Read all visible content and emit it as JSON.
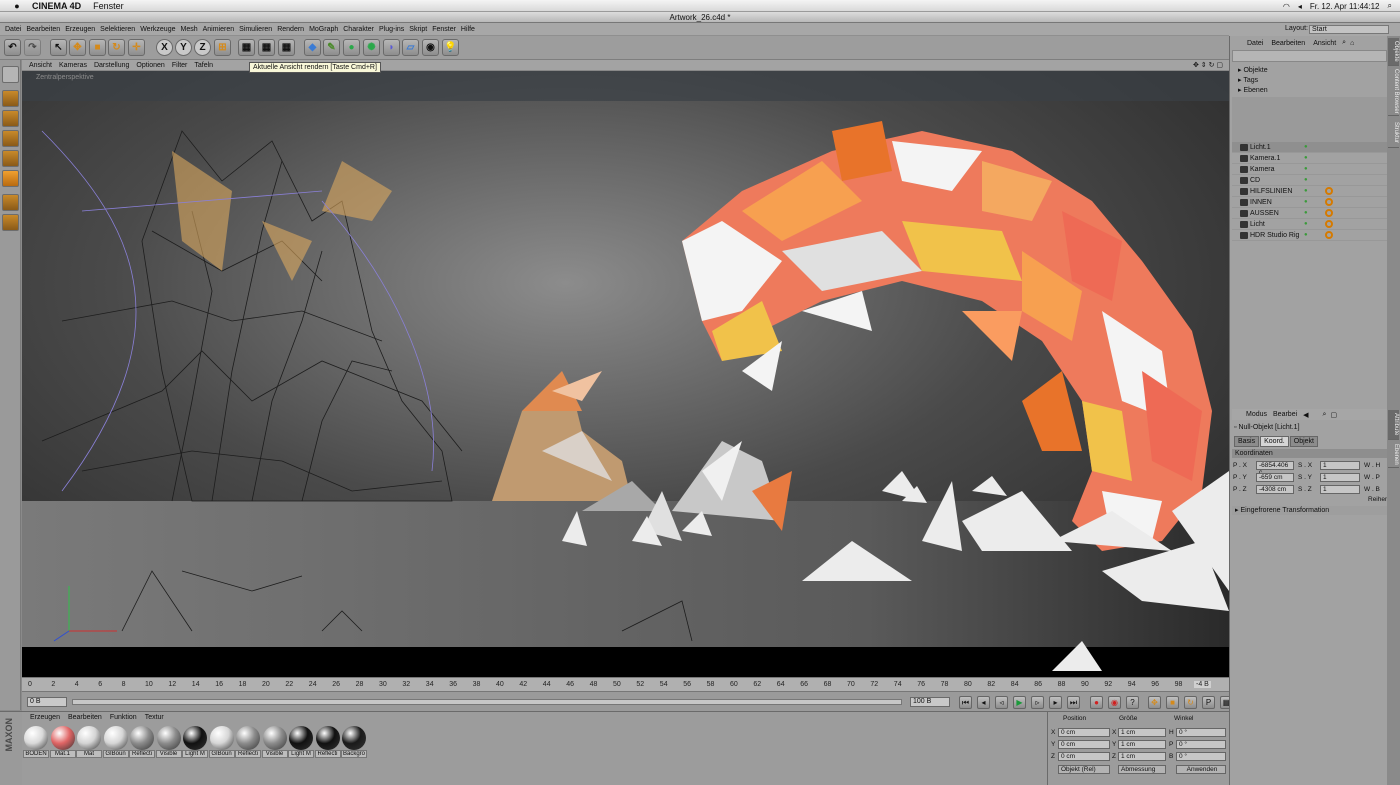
{
  "mac_menu": {
    "app": "CINEMA 4D",
    "window_menu": "Fenster",
    "date_time": "Fr. 12. Apr  11:44:12"
  },
  "window": {
    "title": "Artwork_26.c4d *"
  },
  "main_menu": [
    "Datei",
    "Bearbeiten",
    "Erzeugen",
    "Selektieren",
    "Werkzeuge",
    "Mesh",
    "Animieren",
    "Simulieren",
    "Rendern",
    "MoGraph",
    "Charakter",
    "Plug-ins",
    "Skript",
    "Fenster",
    "Hilfe"
  ],
  "layout": {
    "label": "Layout:",
    "value": "Start"
  },
  "toolbar": {
    "x": "X",
    "y": "Y",
    "z": "Z"
  },
  "tooltip": "Aktuelle Ansicht rendern [Taste Cmd+R]",
  "viewport_menu": [
    "Ansicht",
    "Kameras",
    "Darstellung",
    "Optionen",
    "Filter",
    "Tafeln"
  ],
  "viewport_label": "Zentralperspektive",
  "timeline": {
    "ticks": [
      "0",
      "2",
      "4",
      "6",
      "8",
      "10",
      "12",
      "14",
      "16",
      "18",
      "20",
      "22",
      "24",
      "26",
      "28",
      "30",
      "32",
      "34",
      "36",
      "38",
      "40",
      "42",
      "44",
      "46",
      "48",
      "50",
      "52",
      "54",
      "56",
      "58",
      "60",
      "62",
      "64",
      "66",
      "68",
      "70",
      "72",
      "74",
      "76",
      "78",
      "80",
      "82",
      "84",
      "86",
      "88",
      "90",
      "92",
      "94",
      "96",
      "98",
      "100"
    ],
    "current_frame": "0 B",
    "start_field": "0 B",
    "end_field": "100 B",
    "frame_indicator": "-4 B"
  },
  "material_menu": [
    "Erzeugen",
    "Bearbeiten",
    "Funktion",
    "Textur"
  ],
  "materials": [
    {
      "name": "BODEN",
      "color": "#d9d9d9"
    },
    {
      "name": "Mat.1",
      "color": "#e06565"
    },
    {
      "name": "Mat",
      "color": "#d4d4d4"
    },
    {
      "name": "GIBoun",
      "color": "#d6d6d6"
    },
    {
      "name": "Reflecti",
      "color": "#8c8c8c"
    },
    {
      "name": "Visible",
      "color": "#8c8c8c"
    },
    {
      "name": "Light M",
      "color": "#111111"
    },
    {
      "name": "GIBoun",
      "color": "#d6d6d6"
    },
    {
      "name": "Reflecti",
      "color": "#8c8c8c"
    },
    {
      "name": "Visible",
      "color": "#8c8c8c"
    },
    {
      "name": "Light M",
      "color": "#111111"
    },
    {
      "name": "Reflecti",
      "color": "#111111"
    },
    {
      "name": "Backgro",
      "color": "#1a1a1a"
    }
  ],
  "coordinates": {
    "headers": [
      "Position",
      "Größe",
      "Winkel"
    ],
    "rows": [
      {
        "axis": "X",
        "pos": "0 cm",
        "size_axis": "X",
        "size": "1 cm",
        "rot_axis": "H",
        "rot": "0 °"
      },
      {
        "axis": "Y",
        "pos": "0 cm",
        "size_axis": "Y",
        "size": "1 cm",
        "rot_axis": "P",
        "rot": "0 °"
      },
      {
        "axis": "Z",
        "pos": "0 cm",
        "size_axis": "Z",
        "size": "1 cm",
        "rot_axis": "B",
        "rot": "0 °"
      }
    ],
    "mode": "Objekt (Rel)",
    "size_mode": "Abmessung",
    "apply": "Anwenden"
  },
  "object_manager": {
    "menu": [
      "Datei",
      "Bearbeiten",
      "Ansicht"
    ],
    "filters": [
      "Objekte",
      "Tags",
      "Ebenen"
    ],
    "objects": [
      "Licht.1",
      "Kamera.1",
      "Kamera",
      "CD",
      "HILFSLINIEN",
      "INNEN",
      "AUSSEN",
      "Licht",
      "HDR Studio Rig"
    ]
  },
  "attributes": {
    "menu": [
      "Modus",
      "Bearbei"
    ],
    "object": "Null-Objekt [Licht.1]",
    "tabs": [
      "Basis",
      "Koord.",
      "Objekt"
    ],
    "section": "Koordinaten",
    "rows": [
      {
        "l": "P . X",
        "v": "-6854.406 c",
        "l2": "S . X",
        "v2": "1",
        "l3": "W . H"
      },
      {
        "l": "P . Y",
        "v": "-659 cm",
        "l2": "S . Y",
        "v2": "1",
        "l3": "W . P"
      },
      {
        "l": "P . Z",
        "v": "-4308 cm",
        "l2": "S . Z",
        "v2": "1",
        "l3": "W . B"
      }
    ],
    "order": "Reihen",
    "frozen": "Eingefrorene Transformation"
  },
  "side_tabs": [
    "Objekte",
    "Content Browser",
    "Struktur",
    "Attribute",
    "Ebenen"
  ],
  "colors": {
    "accent_orange": "#e8732a",
    "coral": "#ee6a55",
    "yellow": "#f1c24a",
    "ui_gray": "#9c9c9c"
  }
}
